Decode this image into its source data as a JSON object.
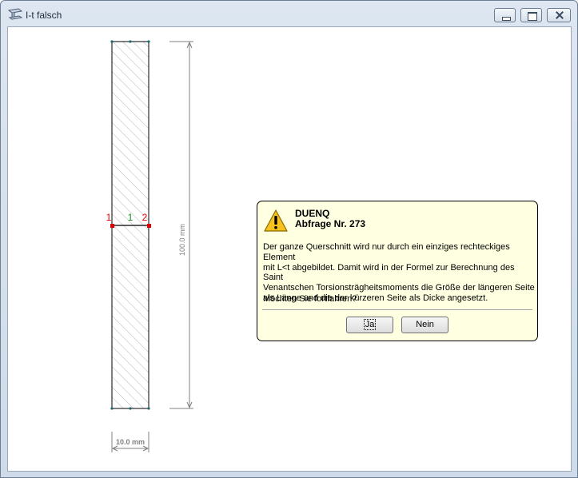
{
  "window": {
    "title": "I-t falsch"
  },
  "drawing": {
    "height_dimension": "100.0 mm",
    "width_dimension": "10.0 mm",
    "node_left": "1",
    "node_right": "2",
    "element_number": "1"
  },
  "dialog": {
    "title": "DUENQ",
    "subtitle": "Abfrage Nr. 273",
    "message": "Der ganze Querschnitt wird nur durch ein einziges rechteckiges Element\nmit L<t abgebildet. Damit wird in der Formel zur Berechnung des Saint\nVenantschen Torsionsträgheitsmoments die Größe der längeren Seite\nals Länge und die der kürzeren Seite als Dicke angesetzt.",
    "question": "Möchten Sie fortfahren?",
    "yes_label": "Ja",
    "no_label": "Nein",
    "icon": "warning-icon"
  },
  "colors": {
    "node": "#dd0000",
    "element_label": "#1a8c1a",
    "dialog_bg": "#ffffe1",
    "dimension": "#808080"
  }
}
